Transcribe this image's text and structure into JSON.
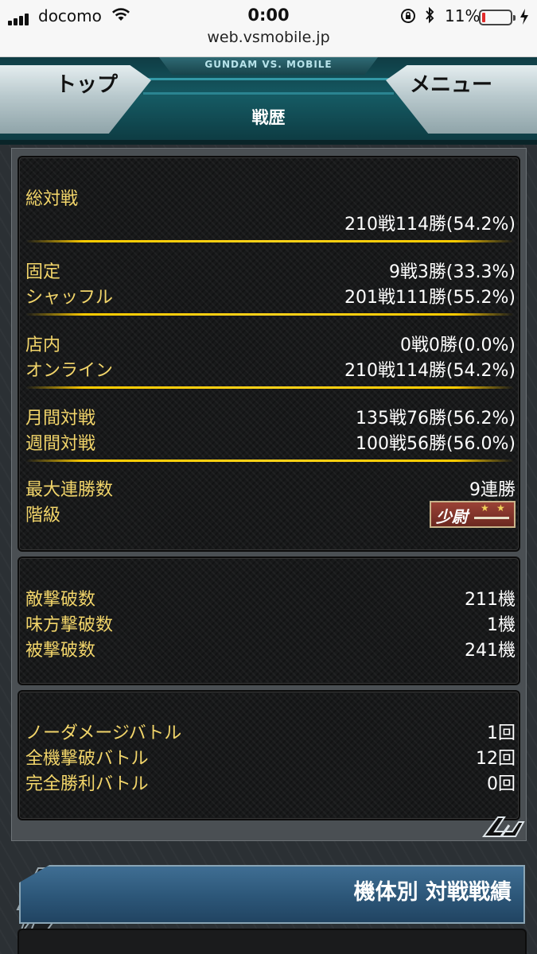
{
  "status_bar": {
    "carrier": "docomo",
    "time": "0:00",
    "battery_percent_label": "11%",
    "battery_level": 0.11,
    "battery_color": "#e02a2a",
    "url": "web.vsmobile.jp"
  },
  "header": {
    "brand": "GUNDAM VS. MOBILE",
    "top_button": "トップ",
    "menu_button": "メニュー",
    "page_title": "戦歴"
  },
  "panel_total": {
    "overall_label": "総対戦",
    "overall_value": "210戦114勝(54.2%)",
    "fixed_label": "固定",
    "fixed_value": "9戦3勝(33.3%)",
    "shuffle_label": "シャッフル",
    "shuffle_value": "201戦111勝(55.2%)",
    "instore_label": "店内",
    "instore_value": "0戦0勝(0.0%)",
    "online_label": "オンライン",
    "online_value": "210戦114勝(54.2%)",
    "monthly_label": "月間対戦",
    "monthly_value": "135戦76勝(56.2%)",
    "weekly_label": "週間対戦",
    "weekly_value": "100戦56勝(56.0%)",
    "max_streak_label": "最大連勝数",
    "max_streak_value": "9連勝",
    "rank_label": "階級",
    "rank_badge_text": "少尉"
  },
  "panel_kills": {
    "enemy_kills_label": "敵撃破数",
    "enemy_kills_value": "211機",
    "ally_kills_label": "味方撃破数",
    "ally_kills_value": "1機",
    "deaths_label": "被撃破数",
    "deaths_value": "241機"
  },
  "panel_special": {
    "no_damage_label": "ノーダメージバトル",
    "no_damage_value": "1回",
    "all_kill_label": "全機撃破バトル",
    "all_kill_value": "12回",
    "perfect_label": "完全勝利バトル",
    "perfect_value": "0回"
  },
  "section": {
    "title": "機体別 対戦戦績"
  },
  "colors": {
    "label_gold": "#f2d56a",
    "divider_gold": "#ffcc00",
    "value_white": "#ffffff"
  }
}
